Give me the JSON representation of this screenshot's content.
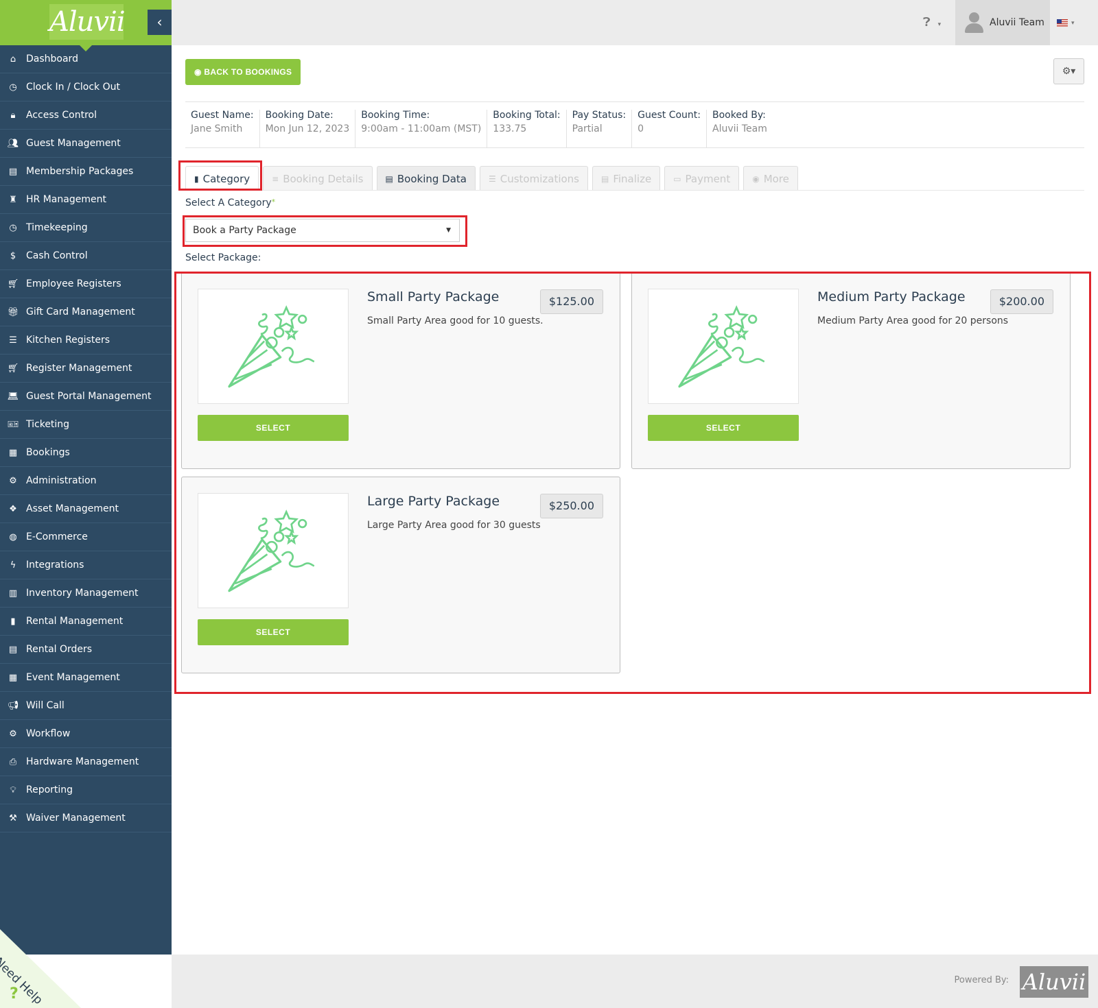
{
  "app": {
    "logo_text": "Aluvii",
    "collapse_glyph": "‹",
    "brand_color": "#8cc63f",
    "sidebar_color": "#2d4a63"
  },
  "sidebar": {
    "items": [
      {
        "label": "Dashboard",
        "icon": "home-icon",
        "glyph": "⌂"
      },
      {
        "label": "Clock In / Clock Out",
        "icon": "clock-icon",
        "glyph": "◷"
      },
      {
        "label": "Access Control",
        "icon": "lock-icon",
        "glyph": "🔒︎"
      },
      {
        "label": "Guest Management",
        "icon": "users-icon",
        "glyph": "👥︎"
      },
      {
        "label": "Membership Packages",
        "icon": "id-card-icon",
        "glyph": "▤"
      },
      {
        "label": "HR Management",
        "icon": "user-tie-icon",
        "glyph": "♜"
      },
      {
        "label": "Timekeeping",
        "icon": "clock-icon",
        "glyph": "◷"
      },
      {
        "label": "Cash Control",
        "icon": "dollar-icon",
        "glyph": "$"
      },
      {
        "label": "Employee Registers",
        "icon": "cart-icon",
        "glyph": "🛒︎"
      },
      {
        "label": "Gift Card Management",
        "icon": "gift-icon",
        "glyph": "🎁︎"
      },
      {
        "label": "Kitchen Registers",
        "icon": "list-icon",
        "glyph": "☰"
      },
      {
        "label": "Register Management",
        "icon": "cart-plus-icon",
        "glyph": "🛒︎"
      },
      {
        "label": "Guest Portal Management",
        "icon": "laptop-icon",
        "glyph": "💻︎"
      },
      {
        "label": "Ticketing",
        "icon": "ticket-icon",
        "glyph": "🎫︎"
      },
      {
        "label": "Bookings",
        "icon": "calendar-plus-icon",
        "glyph": "▦"
      },
      {
        "label": "Administration",
        "icon": "cogs-icon",
        "glyph": "⚙"
      },
      {
        "label": "Asset Management",
        "icon": "cubes-icon",
        "glyph": "❖"
      },
      {
        "label": "E-Commerce",
        "icon": "globe-icon",
        "glyph": "◍"
      },
      {
        "label": "Integrations",
        "icon": "bolt-icon",
        "glyph": "ϟ"
      },
      {
        "label": "Inventory Management",
        "icon": "archive-icon",
        "glyph": "▥"
      },
      {
        "label": "Rental Management",
        "icon": "clipboard-icon",
        "glyph": "▮"
      },
      {
        "label": "Rental Orders",
        "icon": "list-alt-icon",
        "glyph": "▤"
      },
      {
        "label": "Event Management",
        "icon": "calendar-check-icon",
        "glyph": "▦"
      },
      {
        "label": "Will Call",
        "icon": "bullhorn-icon",
        "glyph": "📢︎"
      },
      {
        "label": "Workflow",
        "icon": "cog-icon",
        "glyph": "⚙"
      },
      {
        "label": "Hardware Management",
        "icon": "print-icon",
        "glyph": "⎙"
      },
      {
        "label": "Reporting",
        "icon": "lightbulb-icon",
        "glyph": "💡︎"
      },
      {
        "label": "Waiver Management",
        "icon": "gavel-icon",
        "glyph": "⚒"
      }
    ]
  },
  "need_help": {
    "label": "Need Help",
    "glyph": "?"
  },
  "topbar": {
    "help_glyph": "❓︎",
    "help_caret": "▾",
    "user_name": "Aluvii Team",
    "flag_caret": "▾"
  },
  "toolbar": {
    "back_label": "◉ BACK TO BOOKINGS",
    "gear_label": "⚙▾"
  },
  "booking_info": [
    {
      "label": "Guest Name:",
      "value": "Jane Smith"
    },
    {
      "label": "Booking Date:",
      "value": "Mon Jun 12, 2023"
    },
    {
      "label": "Booking Time:",
      "value": "9:00am - 11:00am (MST)"
    },
    {
      "label": "Booking Total:",
      "value": "133.75"
    },
    {
      "label": "Pay Status:",
      "value": "Partial"
    },
    {
      "label": "Guest Count:",
      "value": "0"
    },
    {
      "label": "Booked By:",
      "value": "Aluvii Team"
    }
  ],
  "tabs": [
    {
      "label": "Category",
      "glyph": "▮",
      "state": "active"
    },
    {
      "label": "Booking Details",
      "glyph": "≡",
      "state": "disabled"
    },
    {
      "label": "Booking Data",
      "glyph": "▤",
      "state": "enabled"
    },
    {
      "label": "Customizations",
      "glyph": "☰",
      "state": "disabled"
    },
    {
      "label": "Finalize",
      "glyph": "▤",
      "state": "disabled"
    },
    {
      "label": "Payment",
      "glyph": "▭",
      "state": "disabled"
    },
    {
      "label": "More",
      "glyph": "◉",
      "state": "disabled"
    }
  ],
  "category": {
    "label": "Select A Category",
    "required_mark": "*",
    "selected": "Book a Party Package",
    "arrow": "▼"
  },
  "packages": {
    "label": "Select Package:",
    "items": [
      {
        "name": "Small Party Package",
        "price": "$125.00",
        "description": "Small Party Area good for 10 guests.",
        "button": "SELECT",
        "image_icon": "party-popper-icon"
      },
      {
        "name": "Medium Party Package",
        "price": "$200.00",
        "description": "Medium Party Area good for 20 persons",
        "button": "SELECT",
        "image_icon": "party-popper-icon"
      },
      {
        "name": "Large Party Package",
        "price": "$250.00",
        "description": "Large Party Area good for 30 guests",
        "button": "SELECT",
        "image_icon": "party-popper-icon"
      }
    ]
  },
  "footer": {
    "powered_by": "Powered By:",
    "logo_text": "Aluvii"
  },
  "highlight_color": "#e0242c"
}
